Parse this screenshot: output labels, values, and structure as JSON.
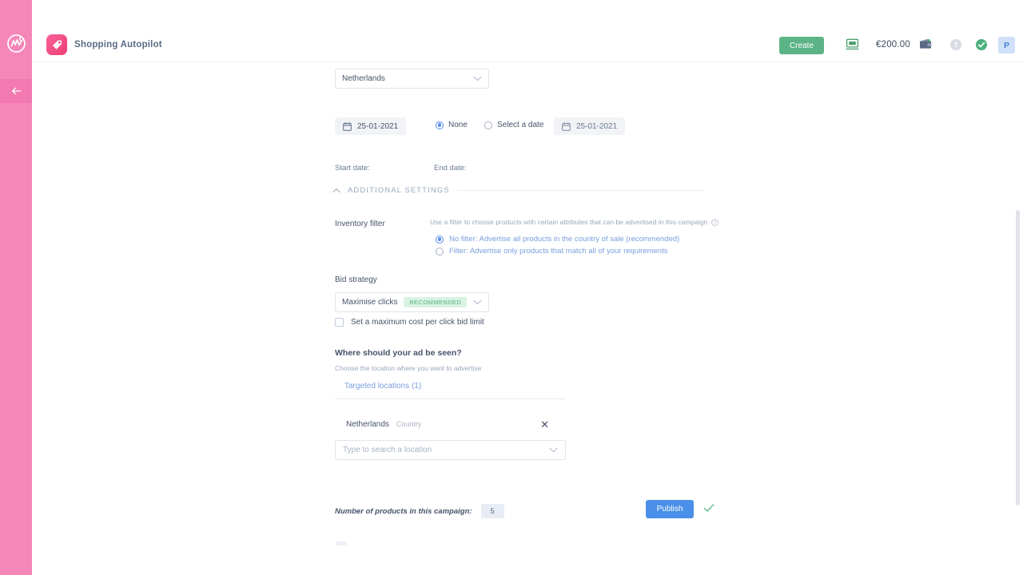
{
  "rail": {
    "logo_icon": "monogram-logo-icon",
    "back_icon": "arrow-left-icon",
    "color": "#f586b8"
  },
  "header": {
    "app_icon": "price-tag-icon",
    "app_title": "Shopping Autopilot",
    "create_label": "Create",
    "monitor_icon": "monitor-icon",
    "balance": "€200.00",
    "wallet_icon": "wallet-icon",
    "help_icon": "help-icon",
    "status_icon": "check-circle-icon",
    "avatar_initial": "P",
    "accent_green": "#5cb486",
    "accent_blue": "#4a90e8"
  },
  "form": {
    "country": {
      "value": "Netherlands",
      "chevron_icon": "chevron-down-icon"
    },
    "start_date": {
      "label": "Start date:",
      "value": "25-01-2021",
      "calendar_icon": "calendar-icon"
    },
    "end_date": {
      "label": "End date:",
      "option_none": "None",
      "option_select": "Select a date",
      "selected": "None",
      "value": "25-01-2021",
      "calendar_icon": "calendar-icon"
    }
  },
  "additional_settings": {
    "title": "ADDITIONAL SETTINGS",
    "collapse_icon": "chevron-up-icon",
    "inventory_filter": {
      "label": "Inventory filter",
      "description": "Use a filter to choose products with certain attributes that can be advertised in this campaign",
      "info_icon": "question-circle-icon",
      "options": [
        "No filter: Advertise all products in the country of sale (recommended)",
        "Filter: Advertise only products that match all of your requirements"
      ],
      "selected_index": 0
    },
    "bid_strategy": {
      "label": "Bid strategy",
      "value": "Maximise clicks",
      "badge": "RECOMMENDED",
      "chevron_icon": "chevron-down-icon",
      "max_cpc_label": "Set a maximum cost per click bid limit",
      "max_cpc_checked": false
    },
    "locations": {
      "title": "Where should your ad be seen?",
      "subtitle": "Choose the location where you want to advertise",
      "tab_label": "Targeted locations (1)",
      "items": [
        {
          "name": "Netherlands",
          "type": "Country",
          "remove_icon": "close-icon"
        }
      ],
      "search_placeholder": "Type to search a location",
      "chevron_icon": "chevron-down-icon"
    }
  },
  "footer": {
    "products_label": "Number of products in this campaign:",
    "products_count": "5",
    "publish_label": "Publish",
    "saved_icon": "check-icon"
  }
}
